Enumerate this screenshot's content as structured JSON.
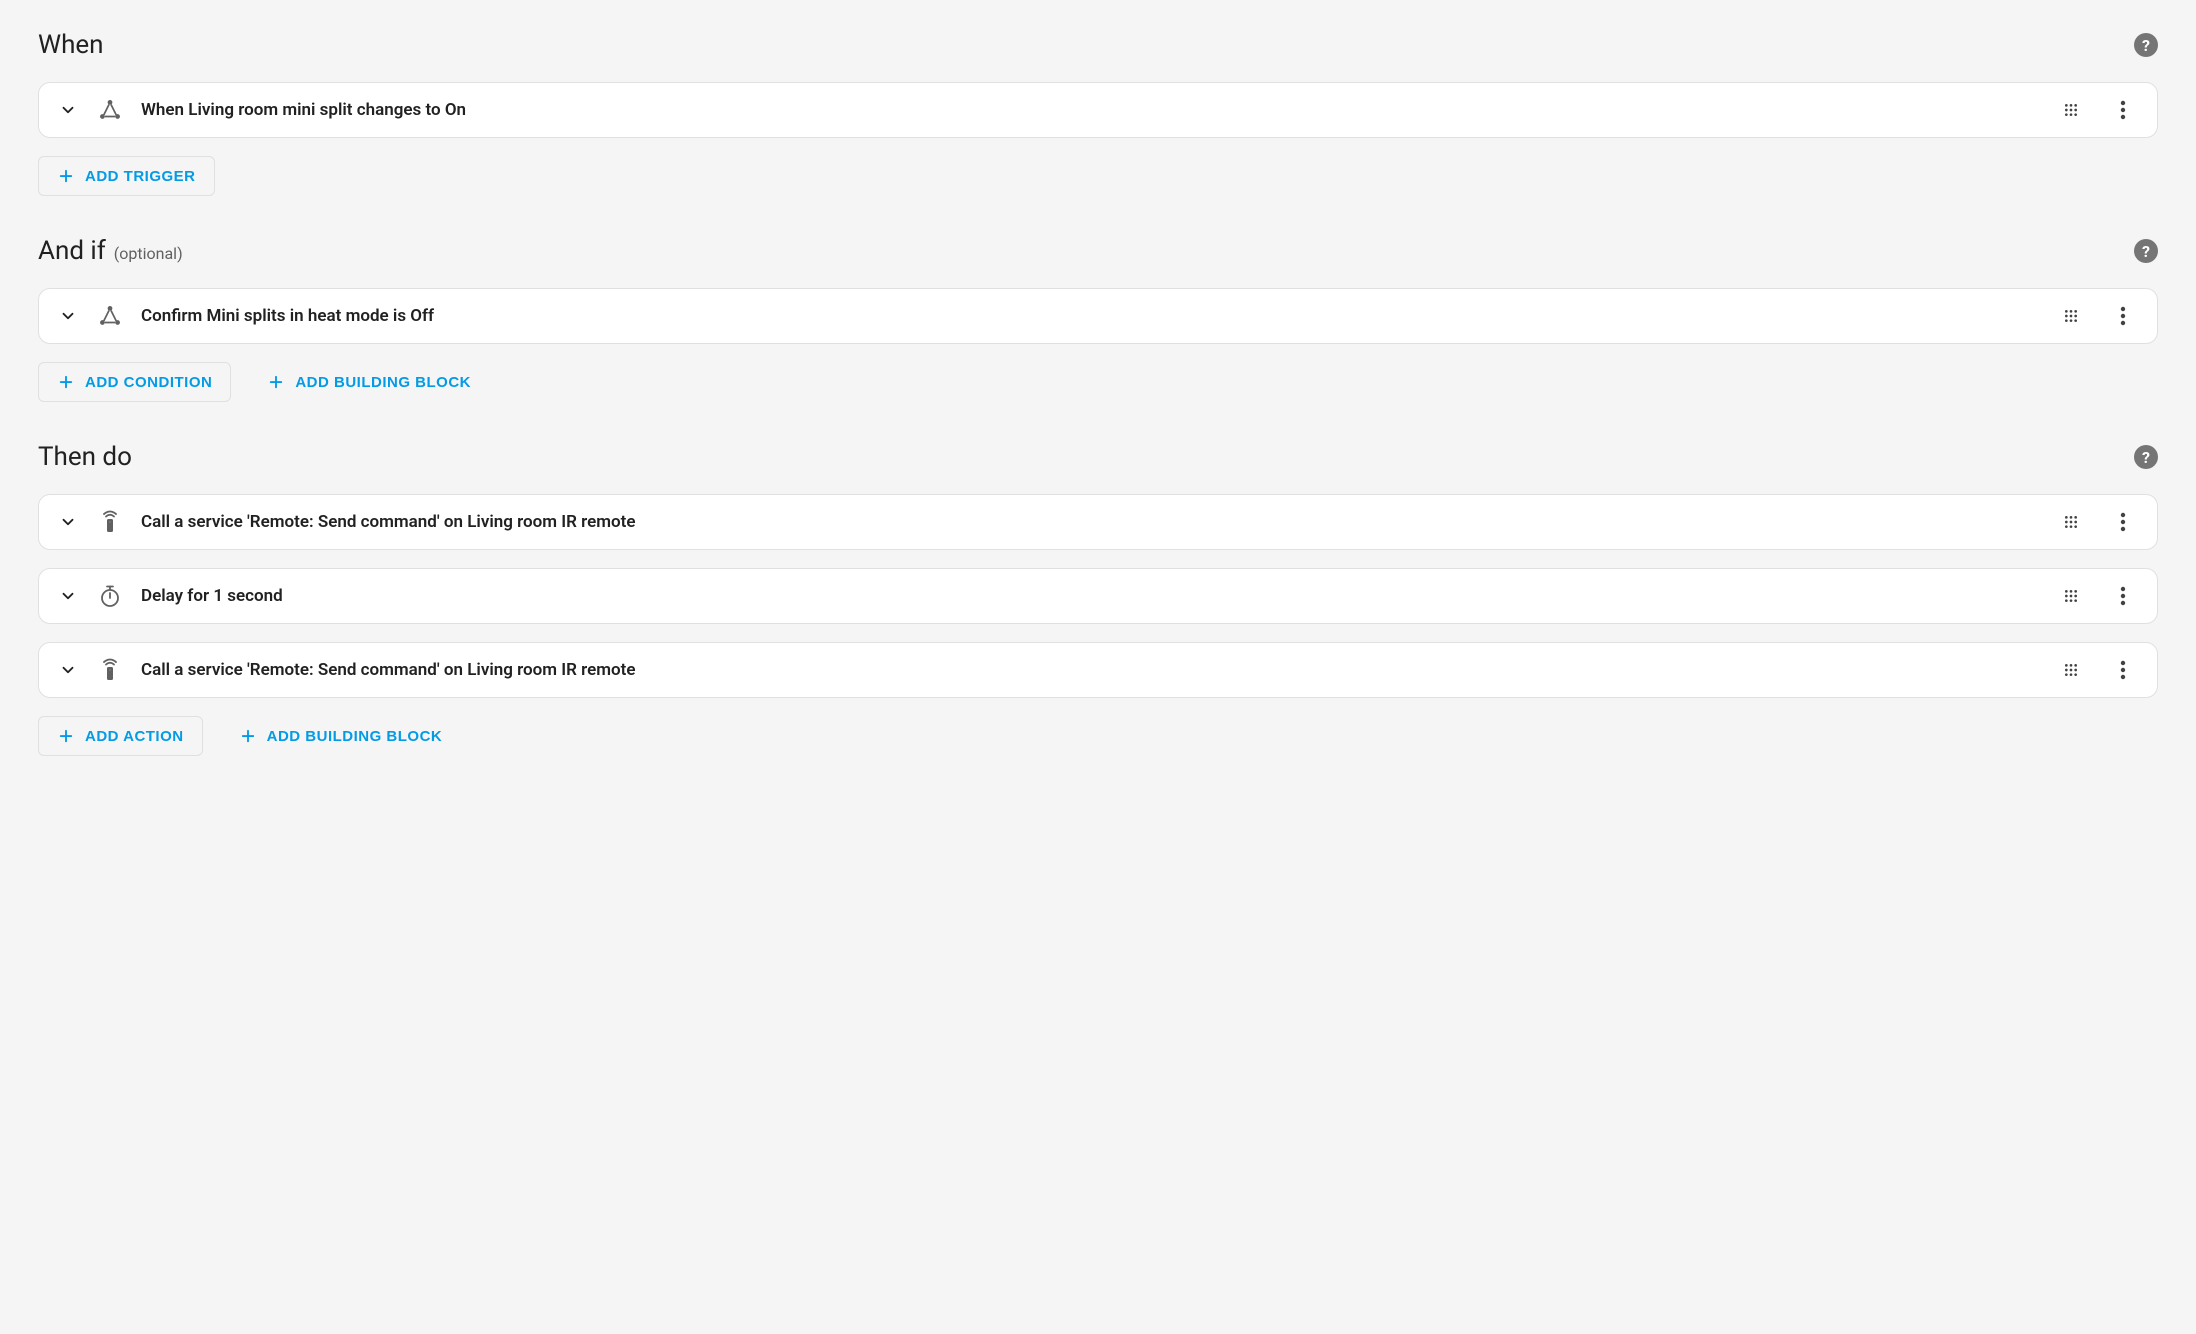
{
  "sections": {
    "when": {
      "title": "When",
      "items": [
        {
          "label": "When Living room mini split changes to On",
          "icon": "state"
        }
      ],
      "buttons": {
        "add_trigger": "Add Trigger"
      }
    },
    "and_if": {
      "title": "And if",
      "optional": "(optional)",
      "items": [
        {
          "label": "Confirm Mini splits in heat mode is Off",
          "icon": "state"
        }
      ],
      "buttons": {
        "add_condition": "Add Condition",
        "add_building_block": "Add Building Block"
      }
    },
    "then_do": {
      "title": "Then do",
      "items": [
        {
          "label": "Call a service 'Remote: Send command' on Living room IR remote",
          "icon": "remote"
        },
        {
          "label": "Delay for 1 second",
          "icon": "timer"
        },
        {
          "label": "Call a service 'Remote: Send command' on Living room IR remote",
          "icon": "remote"
        }
      ],
      "buttons": {
        "add_action": "Add Action",
        "add_building_block": "Add Building Block"
      }
    }
  }
}
